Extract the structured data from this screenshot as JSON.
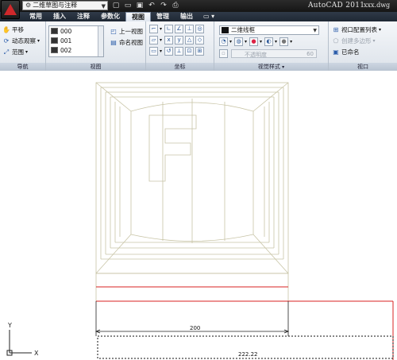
{
  "titlebar": {
    "workspace": "二维草图与注释",
    "app_name": "AutoCAD 2011",
    "doc_name": "xxx.dwg",
    "qat_icons": [
      "new-icon",
      "open-icon",
      "save-icon",
      "undo-icon",
      "redo-icon",
      "plot-icon"
    ]
  },
  "tabs": [
    "常用",
    "插入",
    "注释",
    "参数化",
    "视图",
    "管理",
    "输出"
  ],
  "active_tab": "视图",
  "tab_extra": "▭ ▾",
  "ribbon": {
    "nav": {
      "pan": "平移",
      "orbit": "动态观察",
      "extents": "范围",
      "footer": "导航"
    },
    "views": {
      "items": [
        "000",
        "001",
        "002"
      ],
      "prev_view": "上一视图",
      "named_views": "命名视图",
      "footer": "视图"
    },
    "coords": {
      "footer": "坐标"
    },
    "visual_styles": {
      "style": "二维线框",
      "opacity_label": "不透明度",
      "opacity_value": "60",
      "footer": "视觉样式"
    },
    "viewports": {
      "config": "视口配置列表",
      "create_poly": "创建多边形",
      "named": "已命名",
      "footer": "视口"
    }
  },
  "drawing": {
    "dim_horizontal": "200",
    "dim_bottom": "222.22",
    "ucs_y": "Y",
    "ucs_x": "X",
    "colors": {
      "geometry": "#c8c4a6",
      "red_line": "#d82222",
      "dimension": "#222222"
    }
  }
}
